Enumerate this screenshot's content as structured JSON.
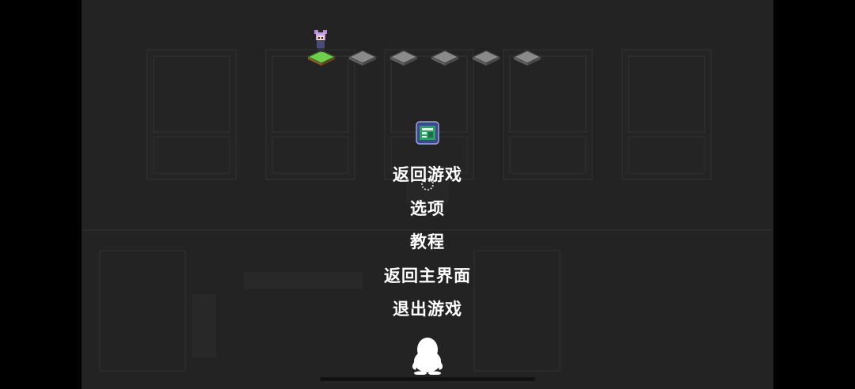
{
  "menu": {
    "items": [
      {
        "id": "resume",
        "label": "返回游戏"
      },
      {
        "id": "options",
        "label": "选项"
      },
      {
        "id": "tutorial",
        "label": "教程"
      },
      {
        "id": "main_menu",
        "label": "返回主界面"
      },
      {
        "id": "quit",
        "label": "退出游戏"
      }
    ]
  },
  "progress": {
    "current_stage": 1,
    "total_stages": 6
  },
  "icons": {
    "menu_badge": "game-logo-icon",
    "loading": "spinner-icon",
    "social": "qq-penguin-icon"
  },
  "colors": {
    "overlay_bg": "#232324",
    "menu_text": "#ffffff",
    "tile_gray": "#8a8a8a",
    "tile_current_grass": "#4caf50"
  }
}
